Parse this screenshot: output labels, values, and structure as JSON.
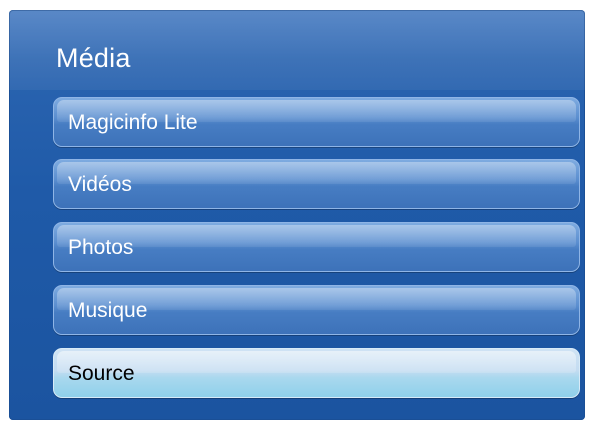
{
  "menu": {
    "title": "Média",
    "items": [
      {
        "label": "Magicinfo Lite",
        "selected": false
      },
      {
        "label": "Vidéos",
        "selected": false
      },
      {
        "label": "Photos",
        "selected": false
      },
      {
        "label": "Musique",
        "selected": false
      },
      {
        "label": "Source",
        "selected": true
      }
    ]
  },
  "colors": {
    "panel": "#1f5aa8",
    "item": "#5c8fd0",
    "selected_item": "#a9d8ee",
    "text": "#ffffff",
    "selected_text": "#000000"
  }
}
